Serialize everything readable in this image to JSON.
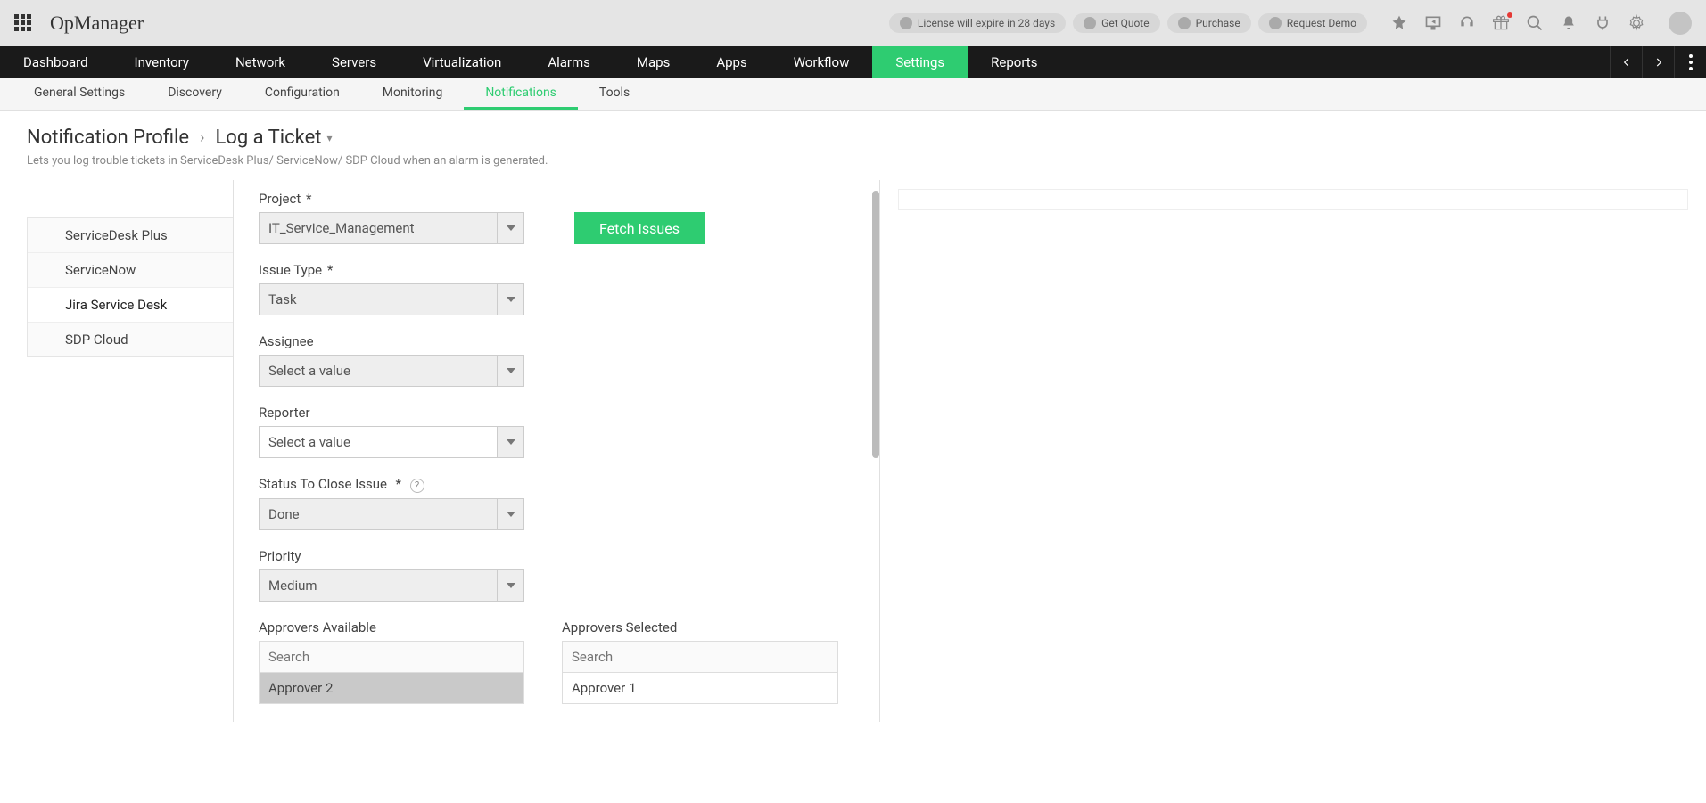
{
  "brand": "OpManager",
  "pills": {
    "license": "License will expire in 28 days",
    "quote": "Get Quote",
    "purchase": "Purchase",
    "demo": "Request Demo"
  },
  "mainnav": [
    "Dashboard",
    "Inventory",
    "Network",
    "Servers",
    "Virtualization",
    "Alarms",
    "Maps",
    "Apps",
    "Workflow",
    "Settings",
    "Reports"
  ],
  "mainnav_active": "Settings",
  "subnav": [
    "General Settings",
    "Discovery",
    "Configuration",
    "Monitoring",
    "Notifications",
    "Tools"
  ],
  "subnav_active": "Notifications",
  "breadcrumb": {
    "parent": "Notification Profile",
    "current": "Log a Ticket"
  },
  "page_desc": "Lets you log trouble tickets in ServiceDesk Plus/ ServiceNow/ SDP Cloud when an alarm is generated.",
  "vtabs": [
    "ServiceDesk Plus",
    "ServiceNow",
    "Jira Service Desk",
    "SDP Cloud"
  ],
  "vtabs_active": "Jira Service Desk",
  "form": {
    "project": {
      "label": "Project",
      "value": "IT_Service_Management"
    },
    "fetch_label": "Fetch Issues",
    "issue_type": {
      "label": "Issue Type",
      "value": "Task"
    },
    "assignee": {
      "label": "Assignee",
      "value": "Select a value"
    },
    "reporter": {
      "label": "Reporter",
      "value": "Select a value"
    },
    "status_close": {
      "label": "Status To Close Issue",
      "value": "Done"
    },
    "priority": {
      "label": "Priority",
      "value": "Medium"
    },
    "approvers_avail": {
      "label": "Approvers Available",
      "search_ph": "Search",
      "items": [
        "Approver 2"
      ]
    },
    "approvers_sel": {
      "label": "Approvers Selected",
      "search_ph": "Search",
      "items": [
        "Approver 1"
      ]
    }
  }
}
